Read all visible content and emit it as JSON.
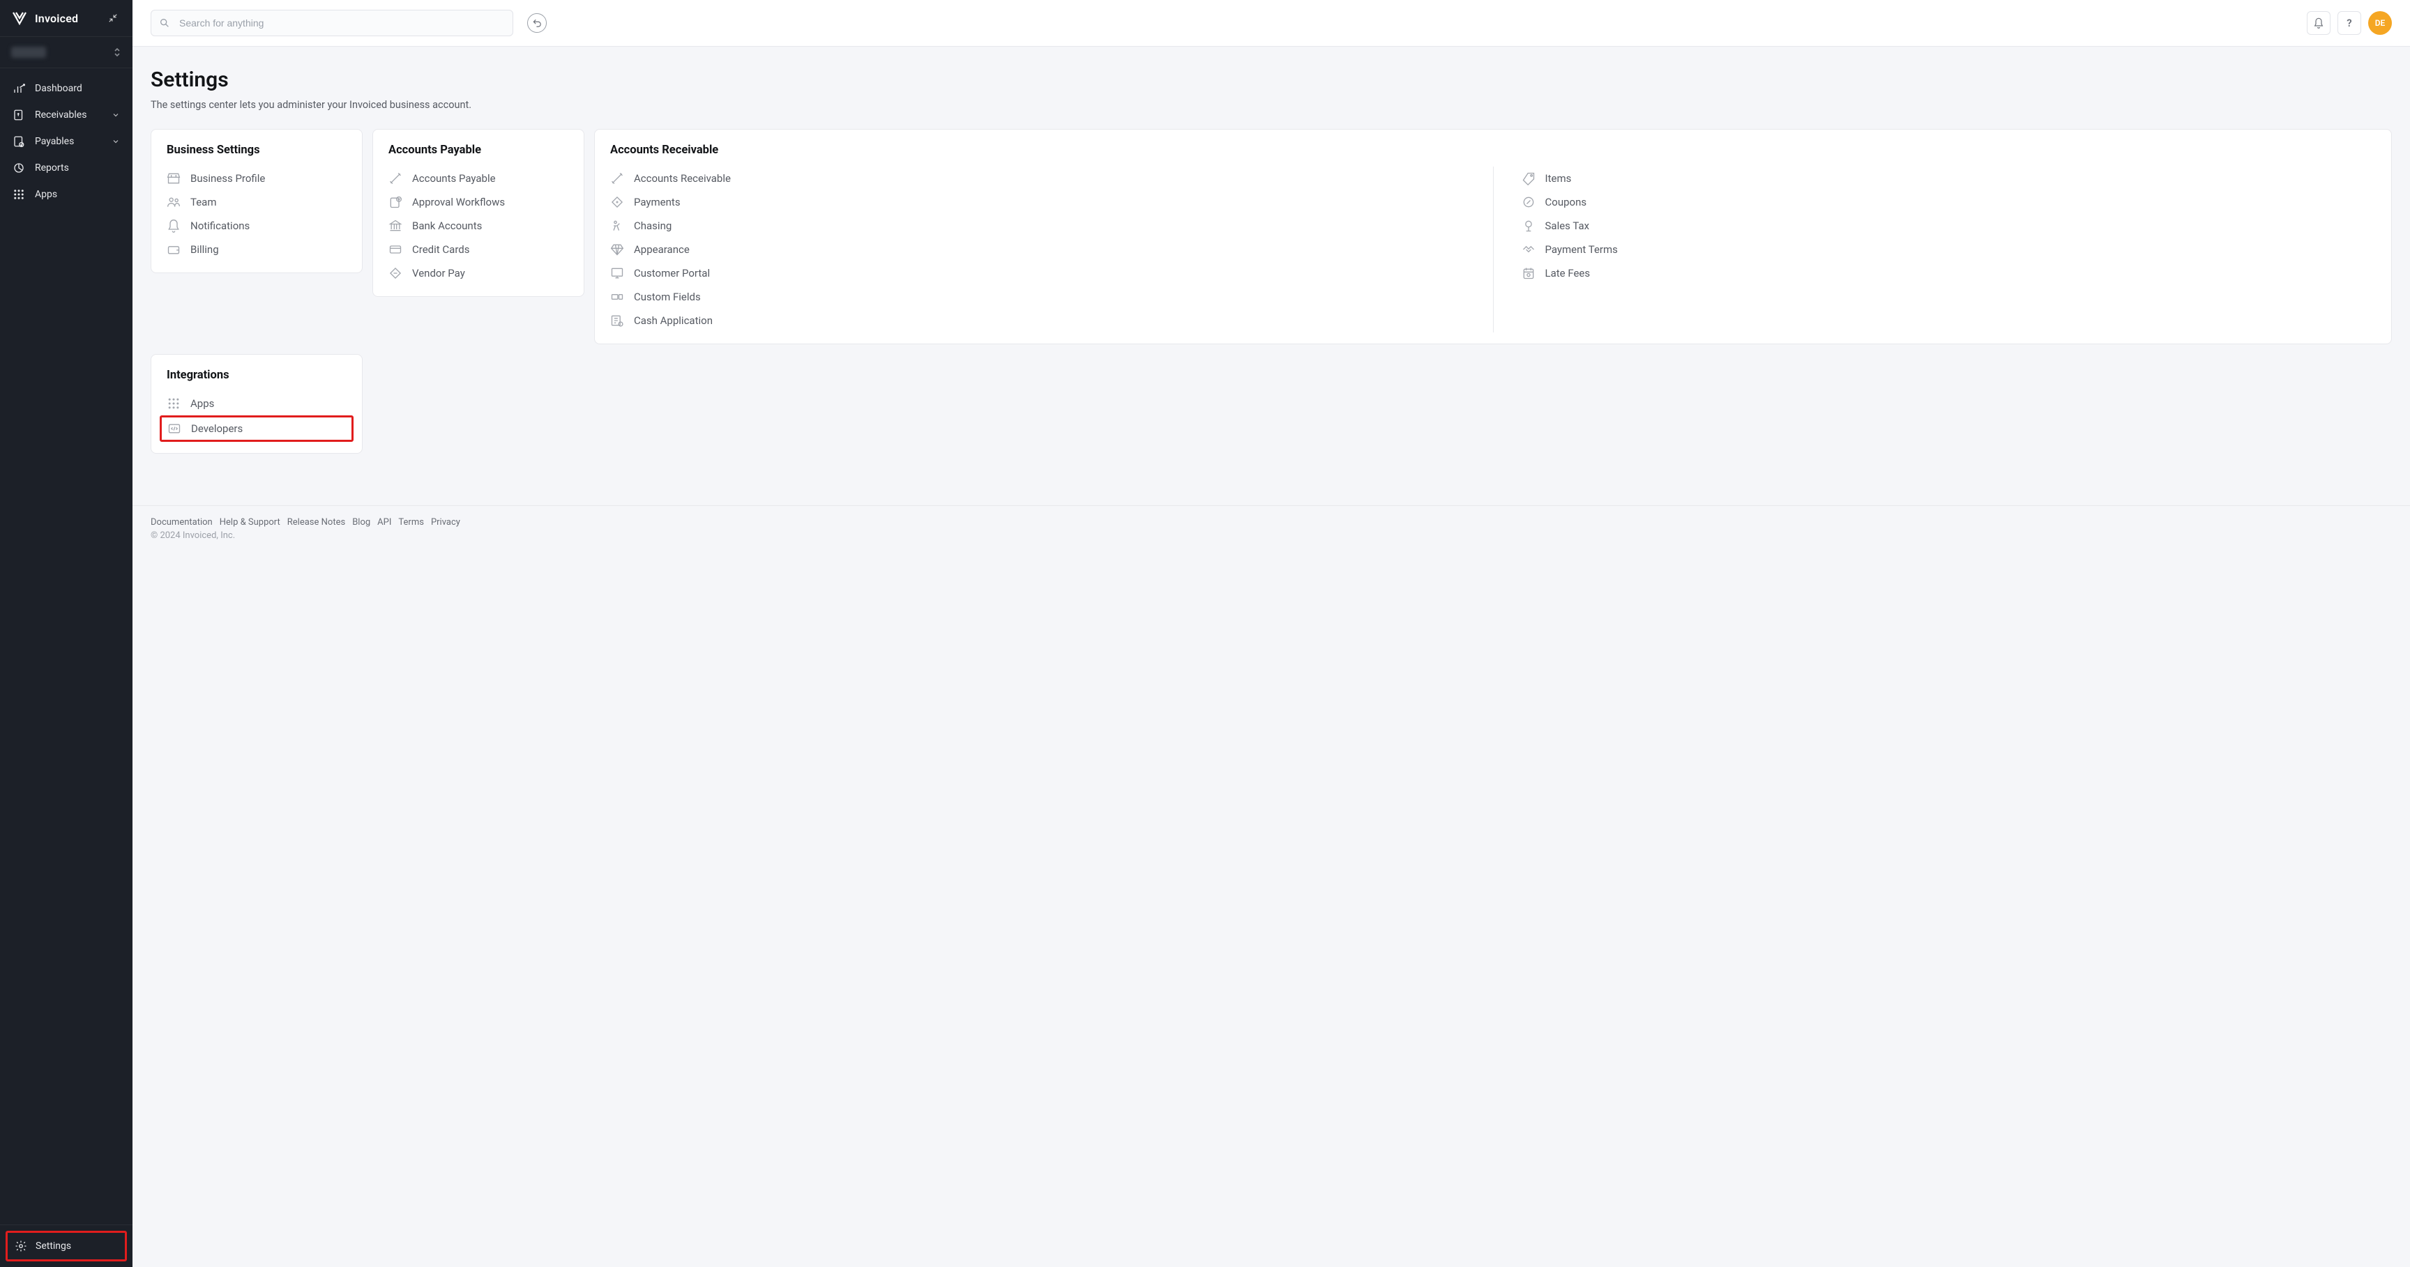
{
  "brand": {
    "name": "Invoiced"
  },
  "search": {
    "placeholder": "Search for anything"
  },
  "avatar": {
    "initials": "DE"
  },
  "sidebar": {
    "items": [
      {
        "label": "Dashboard"
      },
      {
        "label": "Receivables"
      },
      {
        "label": "Payables"
      },
      {
        "label": "Reports"
      },
      {
        "label": "Apps"
      }
    ],
    "footer": {
      "label": "Settings"
    }
  },
  "page": {
    "title": "Settings",
    "subtitle": "The settings center lets you administer your Invoiced business account."
  },
  "cards": {
    "business": {
      "title": "Business Settings",
      "items": [
        {
          "label": "Business Profile"
        },
        {
          "label": "Team"
        },
        {
          "label": "Notifications"
        },
        {
          "label": "Billing"
        }
      ]
    },
    "payable": {
      "title": "Accounts Payable",
      "items": [
        {
          "label": "Accounts Payable"
        },
        {
          "label": "Approval Workflows"
        },
        {
          "label": "Bank Accounts"
        },
        {
          "label": "Credit Cards"
        },
        {
          "label": "Vendor Pay"
        }
      ]
    },
    "receivable": {
      "title": "Accounts Receivable",
      "col1": [
        {
          "label": "Accounts Receivable"
        },
        {
          "label": "Payments"
        },
        {
          "label": "Chasing"
        },
        {
          "label": "Appearance"
        },
        {
          "label": "Customer Portal"
        },
        {
          "label": "Custom Fields"
        },
        {
          "label": "Cash Application"
        }
      ],
      "col2": [
        {
          "label": "Items"
        },
        {
          "label": "Coupons"
        },
        {
          "label": "Sales Tax"
        },
        {
          "label": "Payment Terms"
        },
        {
          "label": "Late Fees"
        }
      ]
    },
    "integrations": {
      "title": "Integrations",
      "items": [
        {
          "label": "Apps"
        },
        {
          "label": "Developers"
        }
      ]
    }
  },
  "footer": {
    "links": [
      "Documentation",
      "Help & Support",
      "Release Notes",
      "Blog",
      "API",
      "Terms",
      "Privacy"
    ],
    "copyright": "© 2024 Invoiced, Inc."
  }
}
